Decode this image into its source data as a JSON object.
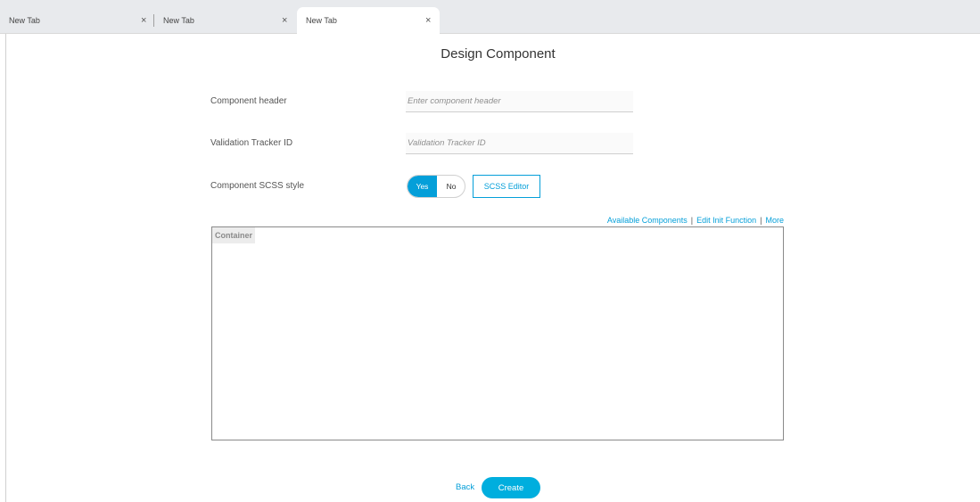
{
  "browser": {
    "tabs": [
      {
        "label": "New Tab",
        "close": "×"
      },
      {
        "label": "New Tab",
        "close": "×"
      },
      {
        "label": "New Tab",
        "close": "×",
        "active": true
      }
    ]
  },
  "page": {
    "title": "Design Component"
  },
  "form": {
    "header": {
      "label": "Component header",
      "placeholder": "Enter component header",
      "value": ""
    },
    "tracker": {
      "label": "Validation Tracker ID",
      "placeholder": "Validation Tracker ID",
      "value": ""
    },
    "scss": {
      "label": "Component SCSS style",
      "yes": "Yes",
      "no": "No",
      "selected": "Yes",
      "editor_button": "SCSS Editor"
    }
  },
  "toolbar_links": {
    "available": "Available Components",
    "init": "Edit Init Function",
    "more": "More",
    "separator": "|"
  },
  "canvas": {
    "container_label": "Container"
  },
  "footer": {
    "back": "Back",
    "create": "Create"
  },
  "colors": {
    "accent": "#049fd9",
    "create_button": "#00aede"
  }
}
